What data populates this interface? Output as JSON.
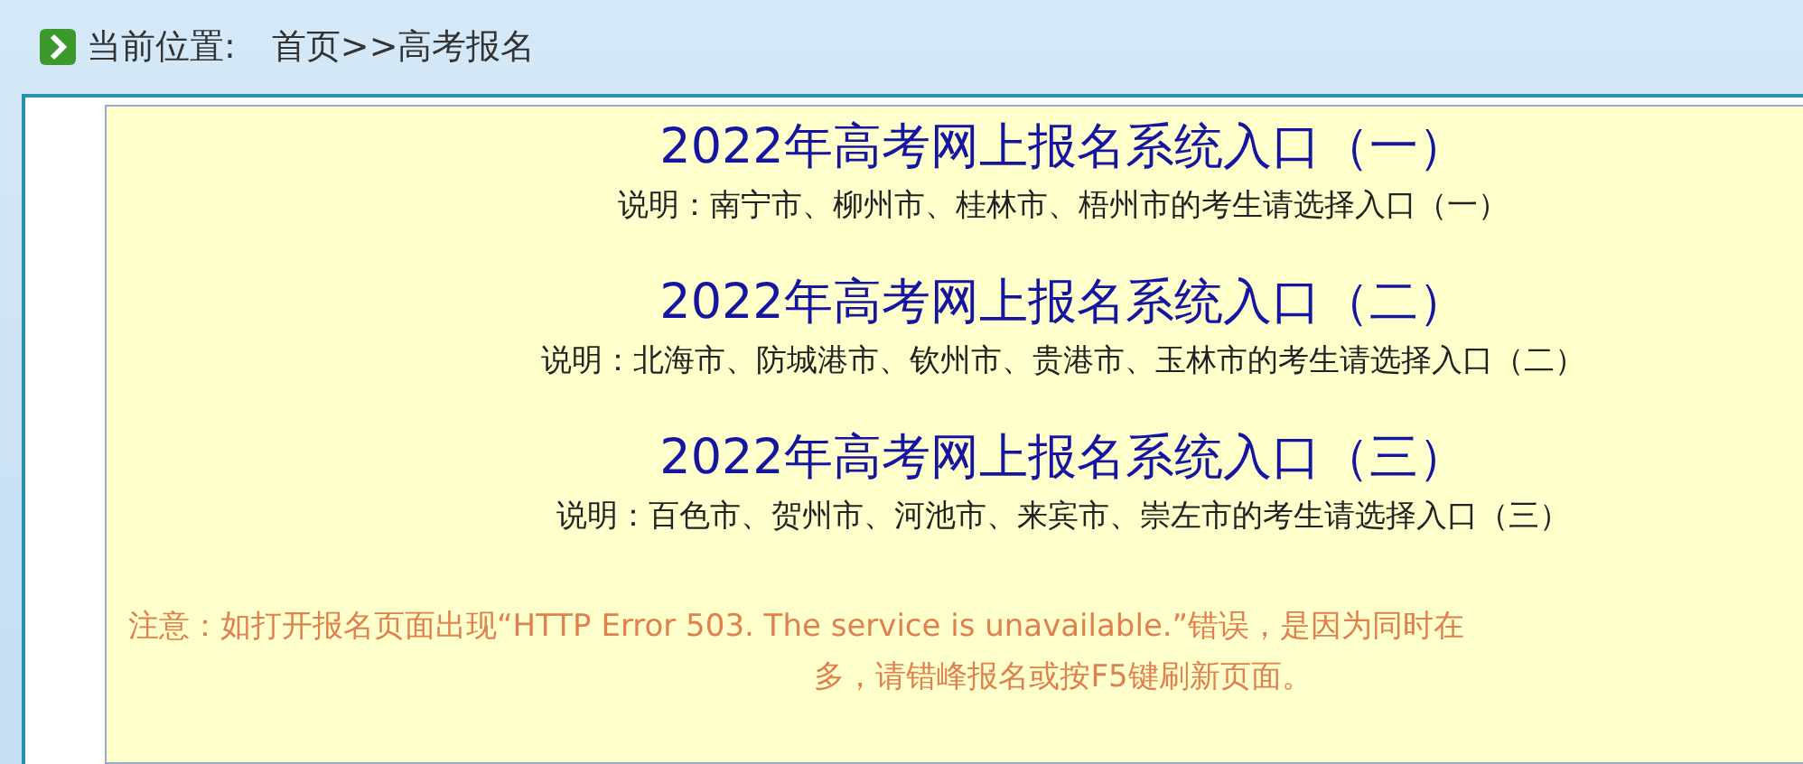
{
  "breadcrumb": {
    "label": "当前位置:",
    "path": "首页>>高考报名"
  },
  "entries": [
    {
      "title": "2022年高考网上报名系统入口（一）",
      "note": "说明：南宁市、柳州市、桂林市、梧州市的考生请选择入口（一）"
    },
    {
      "title": "2022年高考网上报名系统入口（二）",
      "note": "说明：北海市、防城港市、钦州市、贵港市、玉林市的考生请选择入口（二）"
    },
    {
      "title": "2022年高考网上报名系统入口（三）",
      "note": "说明：百色市、贺州市、河池市、来宾市、崇左市的考生请选择入口（三）"
    }
  ],
  "notice": [
    "注意：如打开报名页面出现“HTTP Error 503. The service is unavailable.”错误，是因为同时在",
    "多，请错峰报名或按F5键刷新页面。"
  ]
}
